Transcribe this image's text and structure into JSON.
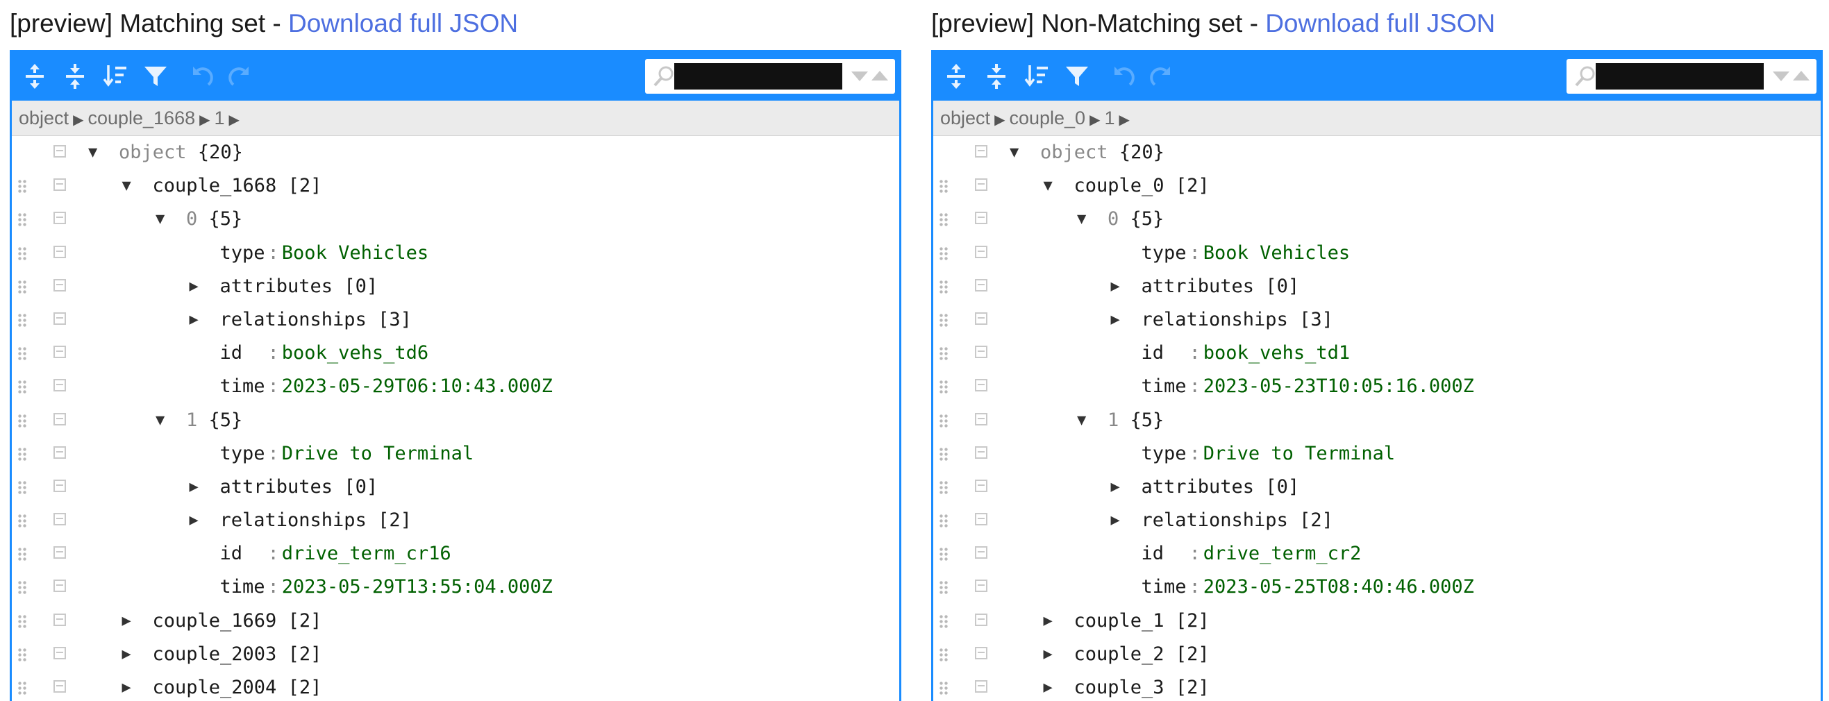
{
  "panels": [
    {
      "heading_prefix": "[preview] Matching set - ",
      "heading_link": "Download full JSON",
      "search_placeholder": "",
      "breadcrumb": [
        "object",
        "couple_1668",
        "1"
      ],
      "rows": [
        {
          "key": "object",
          "count": "{20}",
          "expander": "▼",
          "key_style": "gray"
        },
        {
          "key": "couple_1668",
          "count": "[2]",
          "expander": "▼"
        },
        {
          "key": "0",
          "count": "{5}",
          "expander": "▼",
          "key_style": "gray"
        },
        {
          "key": "type",
          "value": "Book Vehicles"
        },
        {
          "key": "attributes",
          "count": "[0]",
          "expander": "▶"
        },
        {
          "key": "relationships",
          "count": "[3]",
          "expander": "▶"
        },
        {
          "key": "id",
          "value": "book_vehs_td6"
        },
        {
          "key": "time",
          "value": "2023-05-29T06:10:43.000Z"
        },
        {
          "key": "1",
          "count": "{5}",
          "expander": "▼",
          "key_style": "gray"
        },
        {
          "key": "type",
          "value": "Drive to Terminal"
        },
        {
          "key": "attributes",
          "count": "[0]",
          "expander": "▶"
        },
        {
          "key": "relationships",
          "count": "[2]",
          "expander": "▶"
        },
        {
          "key": "id",
          "value": "drive_term_cr16"
        },
        {
          "key": "time",
          "value": "2023-05-29T13:55:04.000Z"
        },
        {
          "key": "couple_1669",
          "count": "[2]",
          "expander": "▶"
        },
        {
          "key": "couple_2003",
          "count": "[2]",
          "expander": "▶"
        },
        {
          "key": "couple_2004",
          "count": "[2]",
          "expander": "▶"
        }
      ]
    },
    {
      "heading_prefix": "[preview] Non-Matching set - ",
      "heading_link": "Download full JSON",
      "search_placeholder": "",
      "breadcrumb": [
        "object",
        "couple_0",
        "1"
      ],
      "rows": [
        {
          "key": "object",
          "count": "{20}",
          "expander": "▼",
          "key_style": "gray"
        },
        {
          "key": "couple_0",
          "count": "[2]",
          "expander": "▼"
        },
        {
          "key": "0",
          "count": "{5}",
          "expander": "▼",
          "key_style": "gray"
        },
        {
          "key": "type",
          "value": "Book Vehicles"
        },
        {
          "key": "attributes",
          "count": "[0]",
          "expander": "▶"
        },
        {
          "key": "relationships",
          "count": "[3]",
          "expander": "▶"
        },
        {
          "key": "id",
          "value": "book_vehs_td1"
        },
        {
          "key": "time",
          "value": "2023-05-23T10:05:16.000Z"
        },
        {
          "key": "1",
          "count": "{5}",
          "expander": "▼",
          "key_style": "gray"
        },
        {
          "key": "type",
          "value": "Drive to Terminal"
        },
        {
          "key": "attributes",
          "count": "[0]",
          "expander": "▶"
        },
        {
          "key": "relationships",
          "count": "[2]",
          "expander": "▶"
        },
        {
          "key": "id",
          "value": "drive_term_cr2"
        },
        {
          "key": "time",
          "value": "2023-05-25T08:40:46.000Z"
        },
        {
          "key": "couple_1",
          "count": "[2]",
          "expander": "▶"
        },
        {
          "key": "couple_2",
          "count": "[2]",
          "expander": "▶"
        },
        {
          "key": "couple_3",
          "count": "[2]",
          "expander": "▶"
        }
      ]
    }
  ],
  "toolbar_icons": [
    "expand-all-icon",
    "collapse-all-icon",
    "sort-icon",
    "filter-icon",
    "undo-icon",
    "redo-icon"
  ],
  "colors": {
    "accent": "#1a8cff",
    "link": "#4d6fe0",
    "string_value": "#006000"
  }
}
